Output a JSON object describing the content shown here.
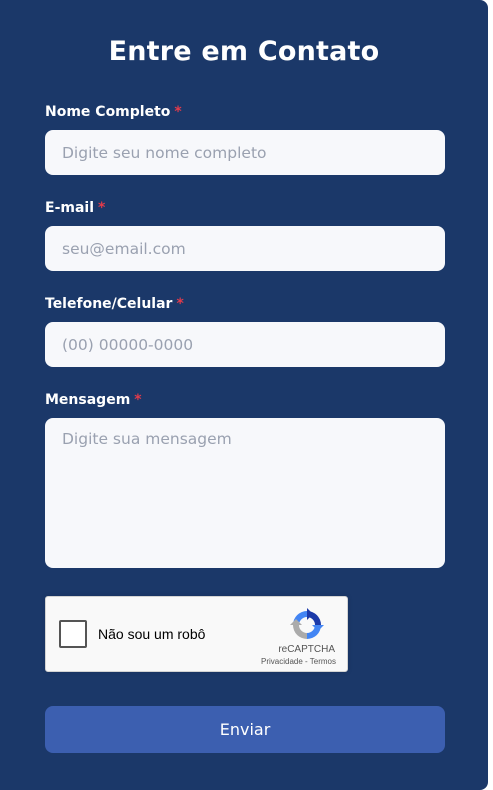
{
  "form": {
    "title": "Entre em Contato",
    "required_mark": "*",
    "name": {
      "label": "Nome Completo",
      "placeholder": "Digite seu nome completo",
      "value": ""
    },
    "email": {
      "label": "E-mail",
      "placeholder": "seu@email.com",
      "value": ""
    },
    "phone": {
      "label": "Telefone/Celular",
      "placeholder": "(00) 00000-0000",
      "value": ""
    },
    "message": {
      "label": "Mensagem",
      "placeholder": "Digite sua mensagem",
      "value": ""
    },
    "submit_label": "Enviar"
  },
  "recaptcha": {
    "label": "Não sou um robô",
    "checked": false,
    "brand": "reCAPTCHA",
    "privacy": "Privacidade",
    "separator": " - ",
    "terms": "Termos",
    "logo_icon": "recaptcha-logo-icon"
  },
  "colors": {
    "panel_bg": "#1b3869",
    "field_bg": "#f7f8fb",
    "required": "#e23b4b",
    "button_bg": "#3c5fb0"
  }
}
